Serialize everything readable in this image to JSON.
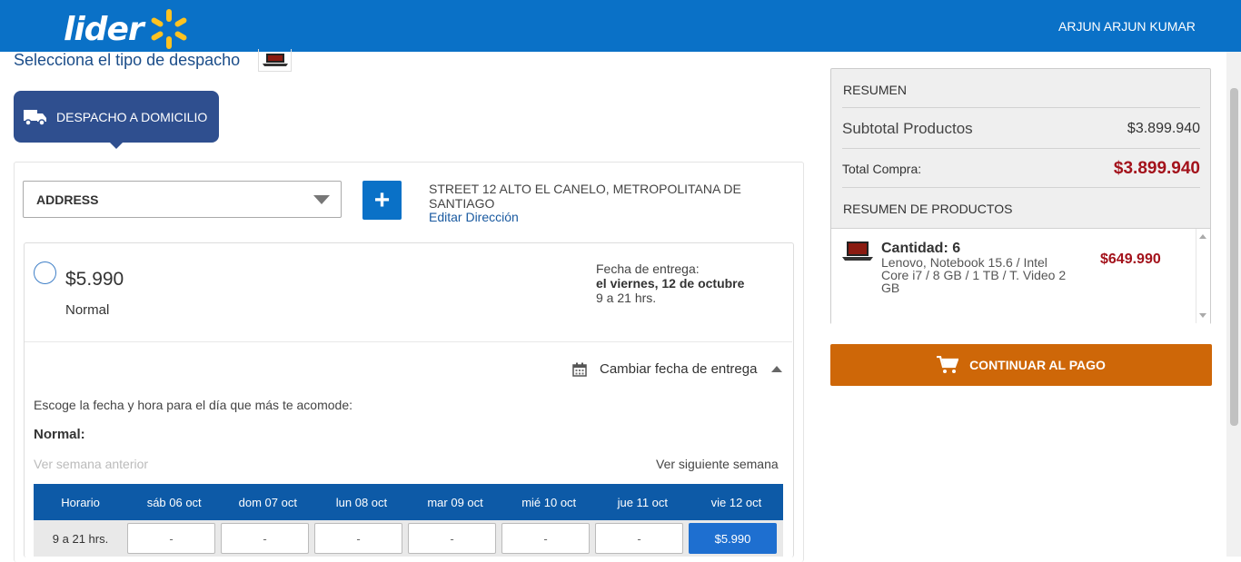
{
  "header": {
    "logo": "lider",
    "user_name": "ARJUN  ARJUN KUMAR"
  },
  "shipping": {
    "title": "Selecciona el tipo de despacho",
    "tab_label": "DESPACHO A DOMICILIO",
    "address_select": "ADDRESS",
    "address_text": "STREET 12 ALTO EL CANELO, METROPOLITANA DE SANTIAGO",
    "edit_link": "Editar Dirección",
    "option": {
      "price": "$5.990",
      "name": "Normal",
      "delivery_label": "Fecha de entrega:",
      "delivery_date": "el viernes, 12 de octubre",
      "delivery_hours": "9 a 21 hrs."
    },
    "change_date": "Cambiar fecha de entrega",
    "instructions": "Escoge la fecha y hora para el día que más te acomode:",
    "normal_label": "Normal:",
    "prev_week": "Ver semana anterior",
    "next_week": "Ver siguiente semana",
    "schedule": {
      "headers": [
        "Horario",
        "sáb 06 oct",
        "dom 07 oct",
        "lun 08 oct",
        "mar 09 oct",
        "mié 10 oct",
        "jue 11 oct",
        "vie 12 oct"
      ],
      "row_label": "9 a 21 hrs.",
      "slots": [
        "-",
        "-",
        "-",
        "-",
        "-",
        "-",
        "$5.990"
      ]
    }
  },
  "summary": {
    "title": "RESUMEN",
    "subtotal_label": "Subtotal Productos",
    "subtotal_value": "$3.899.940",
    "total_label": "Total Compra:",
    "total_value": "$3.899.940",
    "products_title": "RESUMEN DE PRODUCTOS",
    "product": {
      "quantity": "Cantidad: 6",
      "description": "Lenovo, Notebook 15.6 / Intel Core i7 / 8 GB / 1 TB / T. Video 2 GB",
      "price": "$649.990"
    }
  },
  "checkout_button": "CONTINUAR AL PAGO",
  "colors": {
    "header": "#0a71c7",
    "tab": "#2f4f8f",
    "table_header": "#0d5aa7",
    "selected_slot": "#1e6fd0",
    "price_red": "#a3121b",
    "pay_button": "#ce6708"
  }
}
